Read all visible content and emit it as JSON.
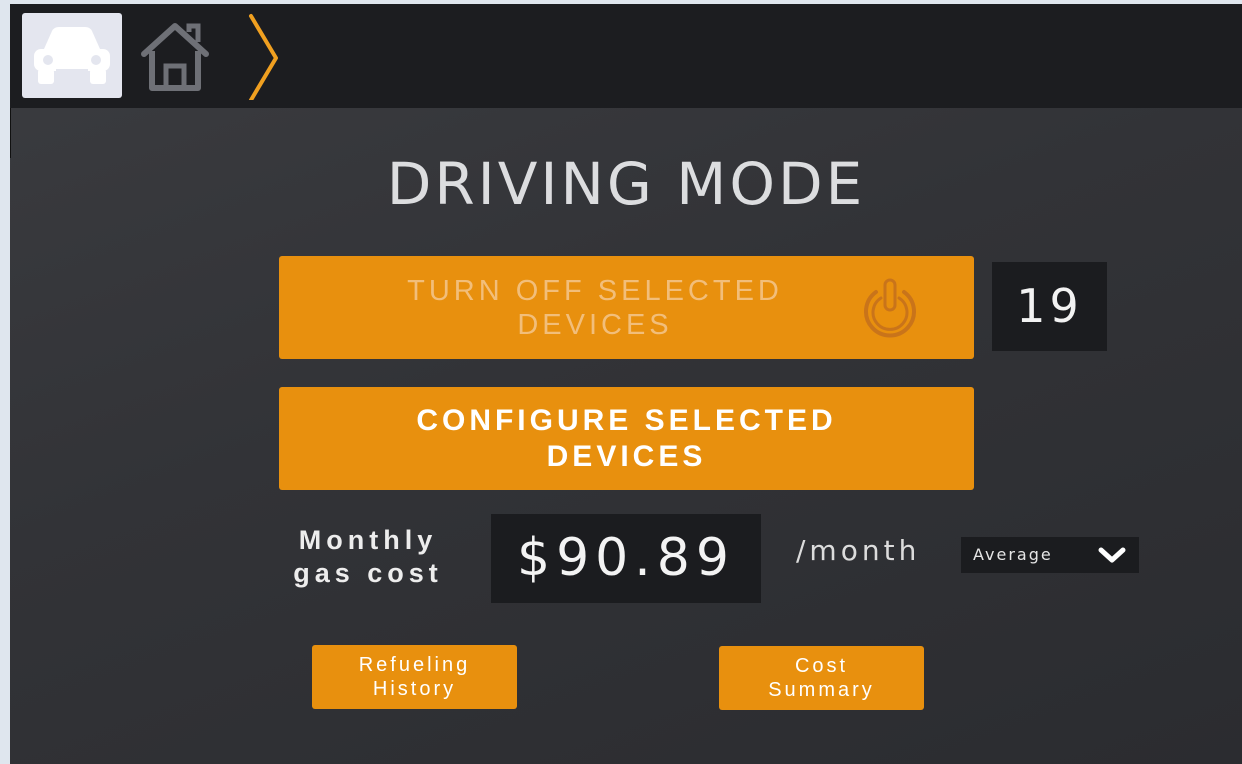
{
  "nav": {
    "tabs": [
      {
        "icon": "car-icon",
        "active": true
      },
      {
        "icon": "home-icon",
        "active": false
      },
      {
        "icon": "chevron-right-icon",
        "active": false
      }
    ]
  },
  "page": {
    "title": "DRIVING MODE"
  },
  "turn_off_button": {
    "line1": "TURN OFF SELECTED",
    "line2": "DEVICES",
    "icon": "power-icon"
  },
  "selected_device_count": "19",
  "configure_button": {
    "line1": "CONFIGURE SELECTED",
    "line2": "DEVICES"
  },
  "gas_cost": {
    "label_line1": "Monthly",
    "label_line2": "gas cost",
    "value": "$90.89",
    "unit": "/month",
    "period_select": "Average"
  },
  "refueling_history_button": {
    "line1": "Refueling",
    "line2": "History"
  },
  "cost_summary_button": {
    "line1": "Cost",
    "line2": "Summary"
  },
  "colors": {
    "accent": "#e8900e",
    "background": "#333438",
    "topbar": "#1c1d20",
    "value_box": "#1b1c1f"
  }
}
